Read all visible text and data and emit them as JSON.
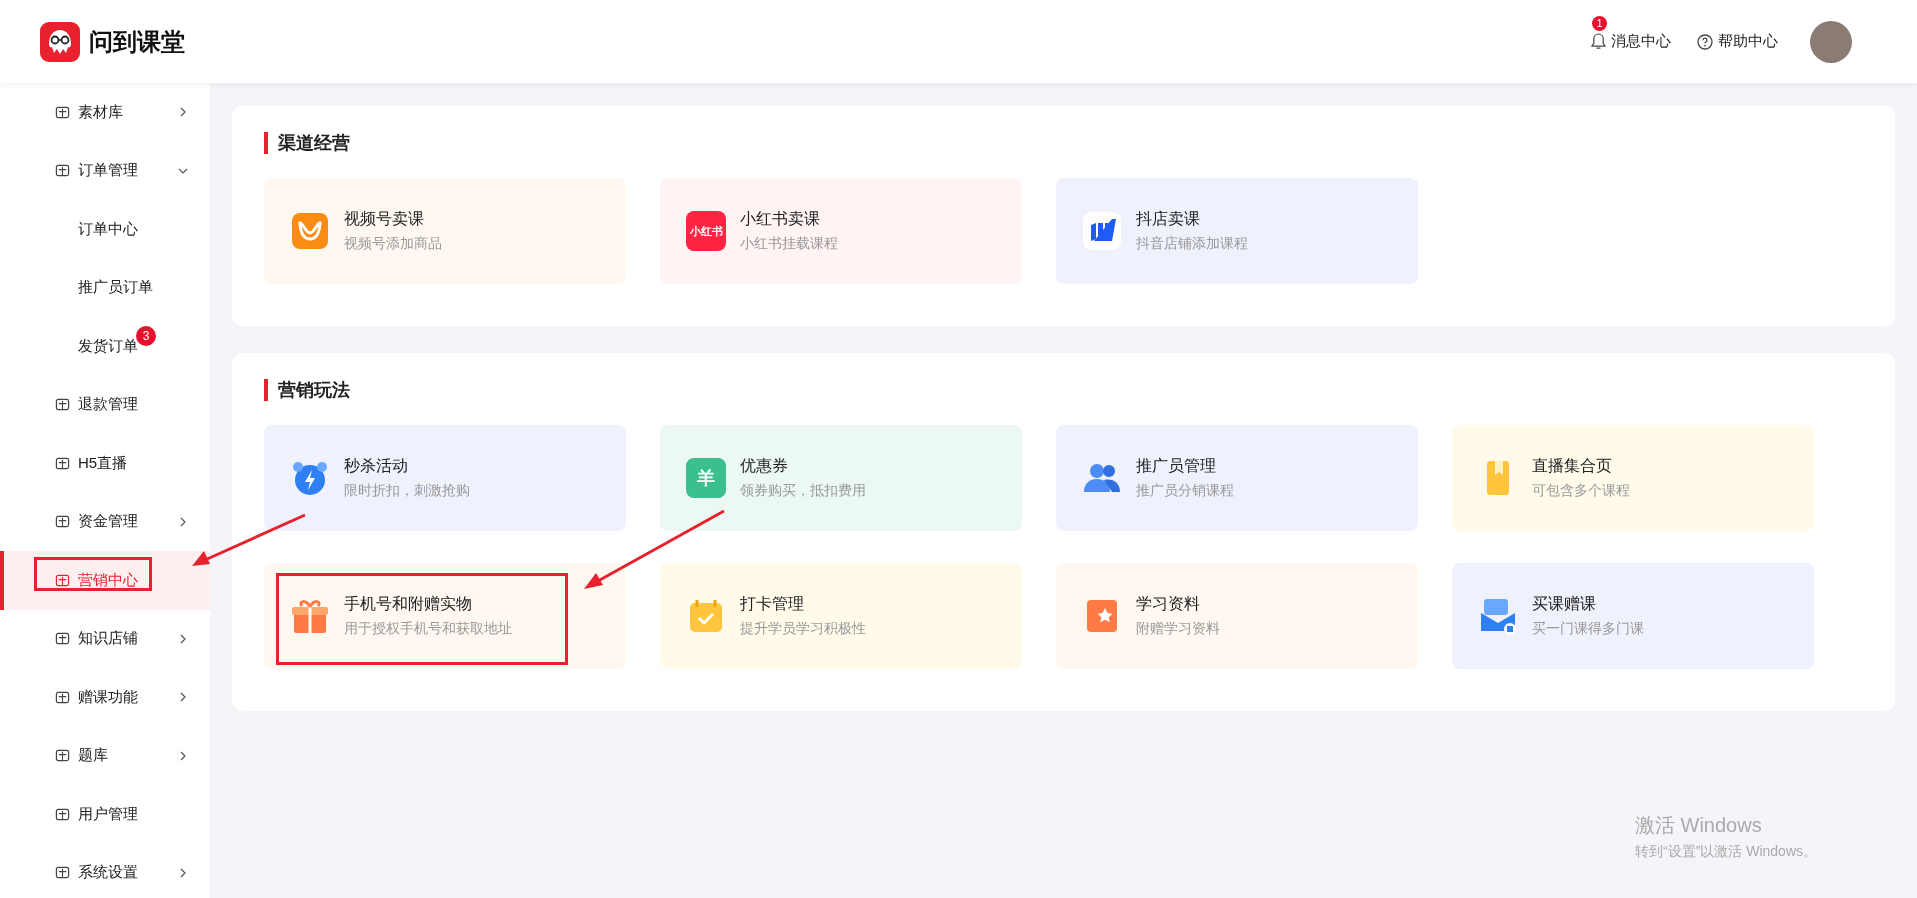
{
  "header": {
    "logo_text": "问到课堂",
    "notifications": {
      "label": "消息中心",
      "badge": "1"
    },
    "help": {
      "label": "帮助中心"
    }
  },
  "sidebar": {
    "items": [
      {
        "label": "素材库",
        "kind": "group",
        "expanded": false,
        "selected": false,
        "highlighted": false
      },
      {
        "label": "订单管理",
        "kind": "group",
        "expanded": true,
        "selected": false,
        "highlighted": false,
        "children": [
          {
            "label": "订单中心",
            "selected": false
          },
          {
            "label": "推广员订单",
            "selected": false
          },
          {
            "label": "发货订单",
            "selected": false,
            "badge": "3"
          }
        ]
      },
      {
        "label": "退款管理",
        "kind": "link",
        "selected": false,
        "highlighted": false
      },
      {
        "label": "H5直播",
        "kind": "link",
        "selected": false,
        "highlighted": false
      },
      {
        "label": "资金管理",
        "kind": "group",
        "expanded": false,
        "selected": false,
        "highlighted": false
      },
      {
        "label": "营销中心",
        "kind": "link",
        "selected": true,
        "highlighted": true
      },
      {
        "label": "知识店铺",
        "kind": "group",
        "expanded": false,
        "selected": false,
        "highlighted": false
      },
      {
        "label": "赠课功能",
        "kind": "group",
        "expanded": false,
        "selected": false,
        "highlighted": false
      },
      {
        "label": "题库",
        "kind": "group",
        "expanded": false,
        "selected": false,
        "highlighted": false
      },
      {
        "label": "用户管理",
        "kind": "link",
        "selected": false,
        "highlighted": false
      },
      {
        "label": "系统设置",
        "kind": "group",
        "expanded": false,
        "selected": false,
        "highlighted": false
      }
    ]
  },
  "sections": [
    {
      "title": "渠道经营",
      "cards": [
        {
          "title": "视频号卖课",
          "description": "视频号添加商品",
          "highlighted": false
        },
        {
          "title": "小红书卖课",
          "description": "小红书挂载课程",
          "highlighted": false,
          "icon_text": "小红书"
        },
        {
          "title": "抖店卖课",
          "description": "抖音店铺添加课程",
          "highlighted": false
        }
      ]
    },
    {
      "title": "营销玩法",
      "cards": [
        {
          "title": "秒杀活动",
          "description": "限时折扣，刺激抢购",
          "highlighted": false
        },
        {
          "title": "优惠券",
          "description": "领券购买，抵扣费用",
          "highlighted": false,
          "icon_text": "羊"
        },
        {
          "title": "推广员管理",
          "description": "推广员分销课程",
          "highlighted": false
        },
        {
          "title": "直播集合页",
          "description": "可包含多个课程",
          "highlighted": false
        },
        {
          "title": "手机号和附赠实物",
          "description": "用于授权手机号和获取地址",
          "highlighted": true
        },
        {
          "title": "打卡管理",
          "description": "提升学员学习积极性",
          "highlighted": false
        },
        {
          "title": "学习资料",
          "description": "附赠学习资料",
          "highlighted": false
        },
        {
          "title": "买课赠课",
          "description": "买一门课得多门课",
          "highlighted": false
        }
      ]
    }
  ],
  "os_notice": {
    "title": "激活 Windows",
    "message": "转到“设置”以激活 Windows。"
  }
}
